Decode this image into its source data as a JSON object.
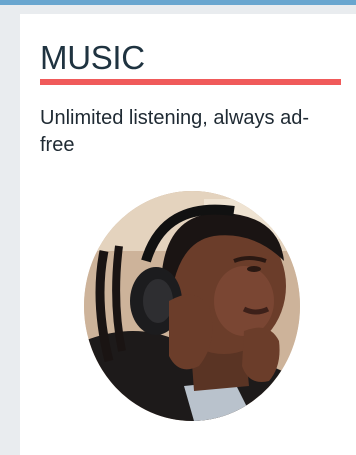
{
  "section": {
    "title": "MUSIC",
    "subtitle": "Unlimited listening, always ad-free"
  },
  "colors": {
    "top_bar": "#69a6cf",
    "title_text": "#1f3340",
    "underline": "#f05a5a",
    "page_background": "#e9ecef",
    "card_background": "#ffffff"
  },
  "image": {
    "subject": "man-listening-with-headphones"
  }
}
